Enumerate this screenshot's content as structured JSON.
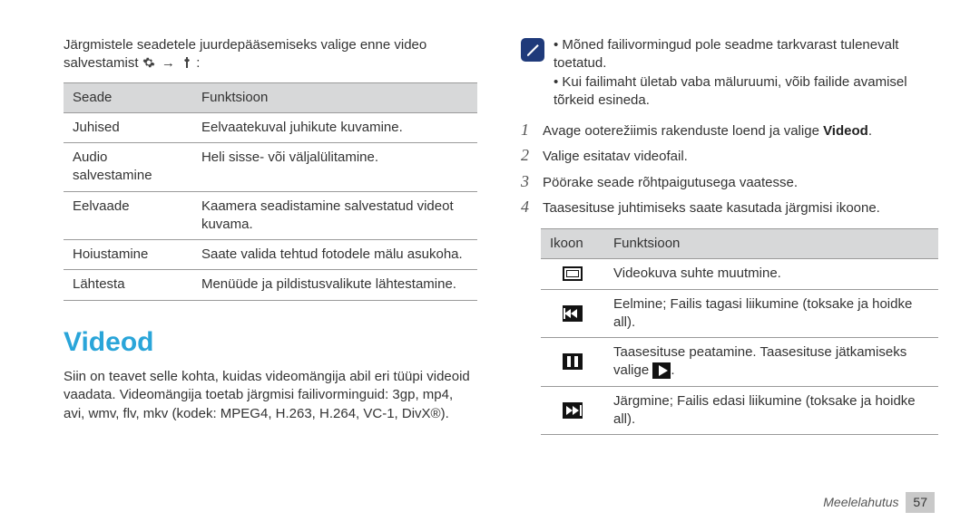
{
  "left": {
    "intro_pre": "Järgmistele seadetele juurdepääsemiseks valige enne video salvestamist ",
    "intro_post": ":",
    "table": {
      "headers": {
        "setting": "Seade",
        "function": "Funktsioon"
      },
      "rows": [
        {
          "setting": "Juhised",
          "function": "Eelvaatekuval juhikute kuvamine."
        },
        {
          "setting": "Audio salvestamine",
          "function": "Heli sisse- või väljalülitamine."
        },
        {
          "setting": "Eelvaade",
          "function": "Kaamera seadistamine salvestatud videot kuvama."
        },
        {
          "setting": "Hoiustamine",
          "function": "Saate valida tehtud fotodele mälu asukoha."
        },
        {
          "setting": "Lähtesta",
          "function": "Menüüde ja pildistusvalikute lähtestamine."
        }
      ]
    },
    "section_title": "Videod",
    "section_body": "Siin on teavet selle kohta, kuidas videomängija abil eri tüüpi videoid vaadata. Videomängija toetab järgmisi failivorminguid: 3gp, mp4, avi, wmv, flv, mkv (kodek: MPEG4, H.263, H.264, VC-1, DivX®)."
  },
  "right": {
    "notes": [
      "Mõned failivormingud pole seadme tarkvarast tulenevalt toetatud.",
      "Kui failimaht ületab vaba mäluruumi, võib failide avamisel tõrkeid esineda."
    ],
    "steps": [
      {
        "num": "1",
        "text_pre": "Avage ooterežiimis rakenduste loend ja valige ",
        "bold": "Videod",
        "text_post": "."
      },
      {
        "num": "2",
        "text_pre": "Valige esitatav videofail.",
        "bold": "",
        "text_post": ""
      },
      {
        "num": "3",
        "text_pre": "Pöörake seade rõhtpaigutusega vaatesse.",
        "bold": "",
        "text_post": ""
      },
      {
        "num": "4",
        "text_pre": "Taasesituse juhtimiseks saate kasutada järgmisi ikoone.",
        "bold": "",
        "text_post": ""
      }
    ],
    "icon_table": {
      "headers": {
        "icon": "Ikoon",
        "function": "Funktsioon"
      },
      "rows": [
        {
          "icon": "screen",
          "function_pre": "Videokuva suhte muutmine.",
          "function_post": ""
        },
        {
          "icon": "prev",
          "function_pre": "Eelmine; Failis tagasi liikumine (toksake ja hoidke all).",
          "function_post": ""
        },
        {
          "icon": "pause",
          "function_pre": "Taasesituse peatamine. Taasesituse jätkamiseks valige ",
          "function_post": "."
        },
        {
          "icon": "next",
          "function_pre": "Järgmine; Failis edasi liikumine (toksake ja hoidke all).",
          "function_post": ""
        }
      ]
    },
    "footer": {
      "section": "Meelelahutus",
      "page": "57"
    }
  }
}
